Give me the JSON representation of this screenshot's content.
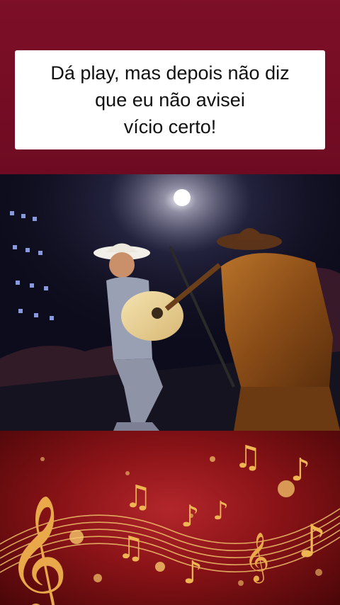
{
  "caption": {
    "text": "Dá play, mas depois não diz\nque eu não avisei\nvício certo!"
  },
  "video": {
    "scene": "concert-stage-two-performers"
  },
  "decoration": {
    "theme": "golden-music-notes",
    "accent_color": "#f5b84a"
  },
  "colors": {
    "background": "#7a0f25",
    "caption_bg": "#ffffff",
    "caption_text": "#111111"
  }
}
